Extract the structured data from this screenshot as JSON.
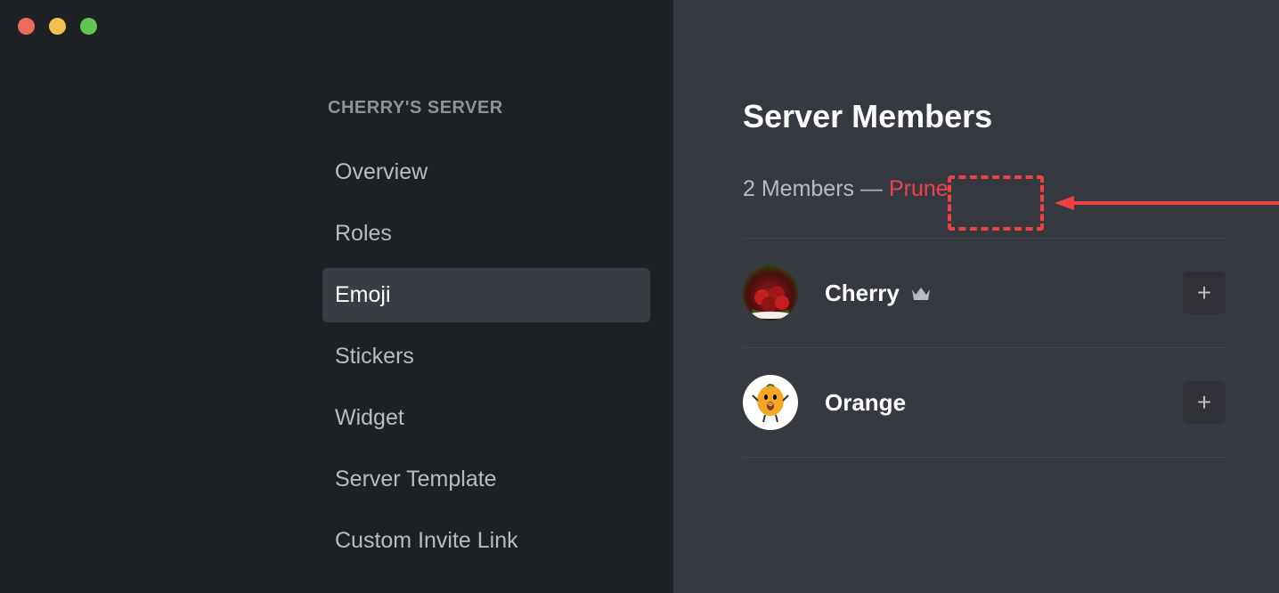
{
  "sidebar": {
    "header": "CHERRY'S SERVER",
    "items": [
      {
        "label": "Overview",
        "active": false
      },
      {
        "label": "Roles",
        "active": false
      },
      {
        "label": "Emoji",
        "active": true
      },
      {
        "label": "Stickers",
        "active": false
      },
      {
        "label": "Widget",
        "active": false
      },
      {
        "label": "Server Template",
        "active": false
      },
      {
        "label": "Custom Invite Link",
        "active": false
      }
    ]
  },
  "main": {
    "title": "Server Members",
    "member_count_text": "2 Members — ",
    "prune_label": "Prune",
    "members": [
      {
        "name": "Cherry",
        "owner": true,
        "avatar": "cherry"
      },
      {
        "name": "Orange",
        "owner": false,
        "avatar": "orange"
      }
    ]
  }
}
